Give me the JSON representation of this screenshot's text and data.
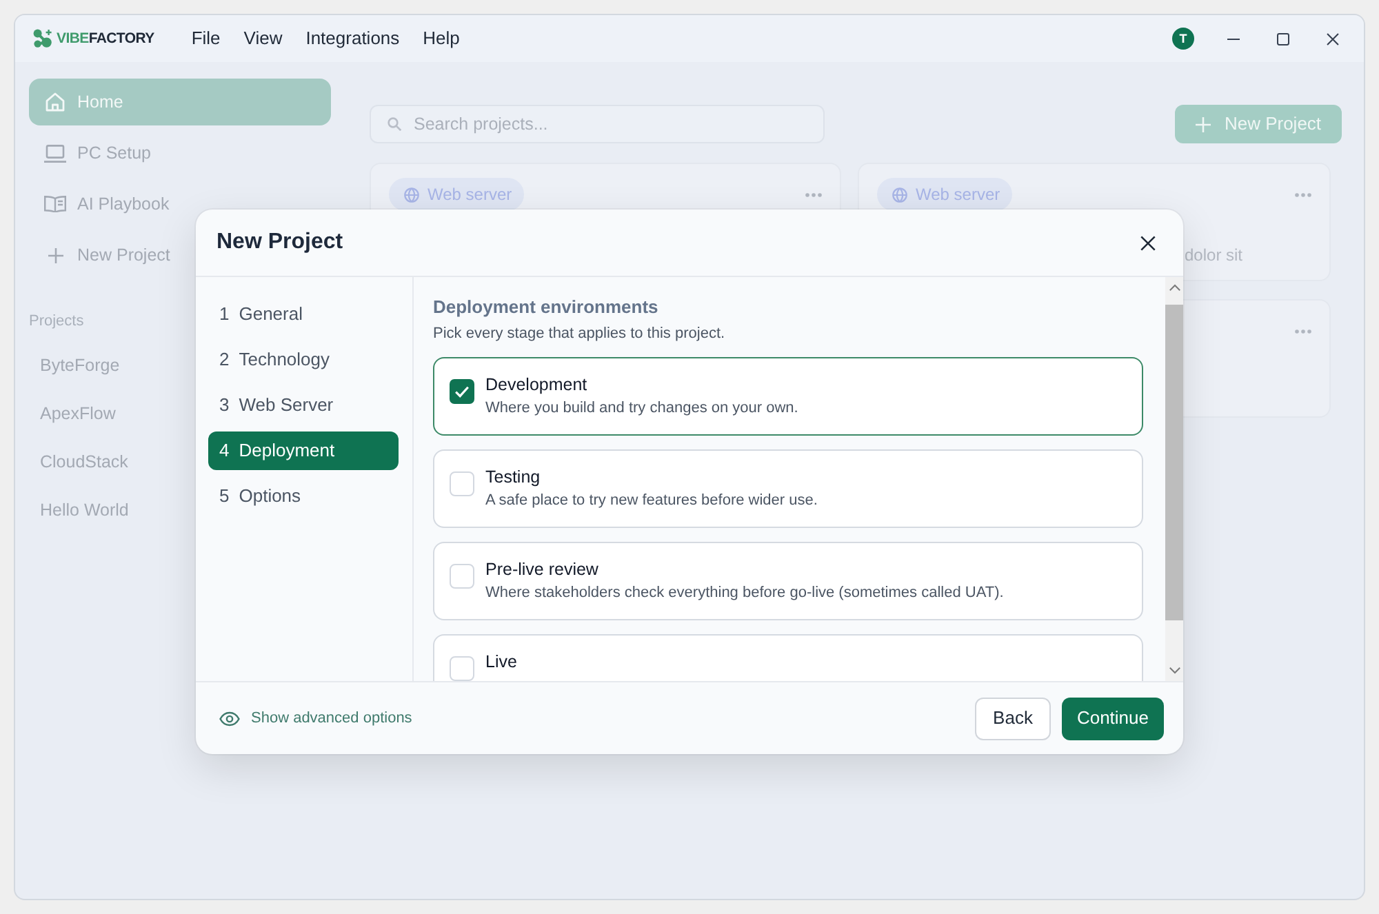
{
  "window": {
    "logo": {
      "accent": "VIBE",
      "rest": "FACTORY"
    },
    "menu": [
      "File",
      "View",
      "Integrations",
      "Help"
    ],
    "avatar": "T"
  },
  "sidebar": {
    "items": [
      {
        "label": "Home",
        "selected": true
      },
      {
        "label": "PC Setup",
        "selected": false
      },
      {
        "label": "AI Playbook",
        "selected": false
      },
      {
        "label": "New Project",
        "selected": false
      }
    ],
    "projects_heading": "Projects",
    "projects": [
      "ByteForge",
      "ApexFlow",
      "CloudStack",
      "Hello World"
    ]
  },
  "main": {
    "search": {
      "placeholder": "Search projects..."
    },
    "new_project_button": "New Project",
    "cards": [
      {
        "tag": "Web server",
        "menu": true
      },
      {
        "tag": "Web server",
        "description": "dolor sit",
        "menu": true
      },
      {
        "menu": true
      }
    ]
  },
  "dialog": {
    "title": "New Project",
    "steps": [
      {
        "number": "1",
        "label": "General",
        "selected": false
      },
      {
        "number": "2",
        "label": "Technology",
        "selected": false
      },
      {
        "number": "3",
        "label": "Web Server",
        "selected": false
      },
      {
        "number": "4",
        "label": "Deployment",
        "selected": true
      },
      {
        "number": "5",
        "label": "Options",
        "selected": false
      }
    ],
    "section": {
      "title": "Deployment environments",
      "subtitle": "Pick every stage that applies to this project.",
      "options": [
        {
          "title": "Development",
          "description": "Where you build and try changes on your own.",
          "checked": true
        },
        {
          "title": "Testing",
          "description": "A safe place to try new features before wider use.",
          "checked": false
        },
        {
          "title": "Pre-live review",
          "description": "Where stakeholders check everything before go-live (sometimes called UAT).",
          "checked": false
        },
        {
          "title": "Live",
          "checked": false
        }
      ]
    },
    "footer": {
      "advanced_link": "Show advanced options",
      "buttons": [
        {
          "label": "Back",
          "kind": "secondary"
        },
        {
          "label": "Continue",
          "kind": "primary"
        }
      ]
    }
  }
}
